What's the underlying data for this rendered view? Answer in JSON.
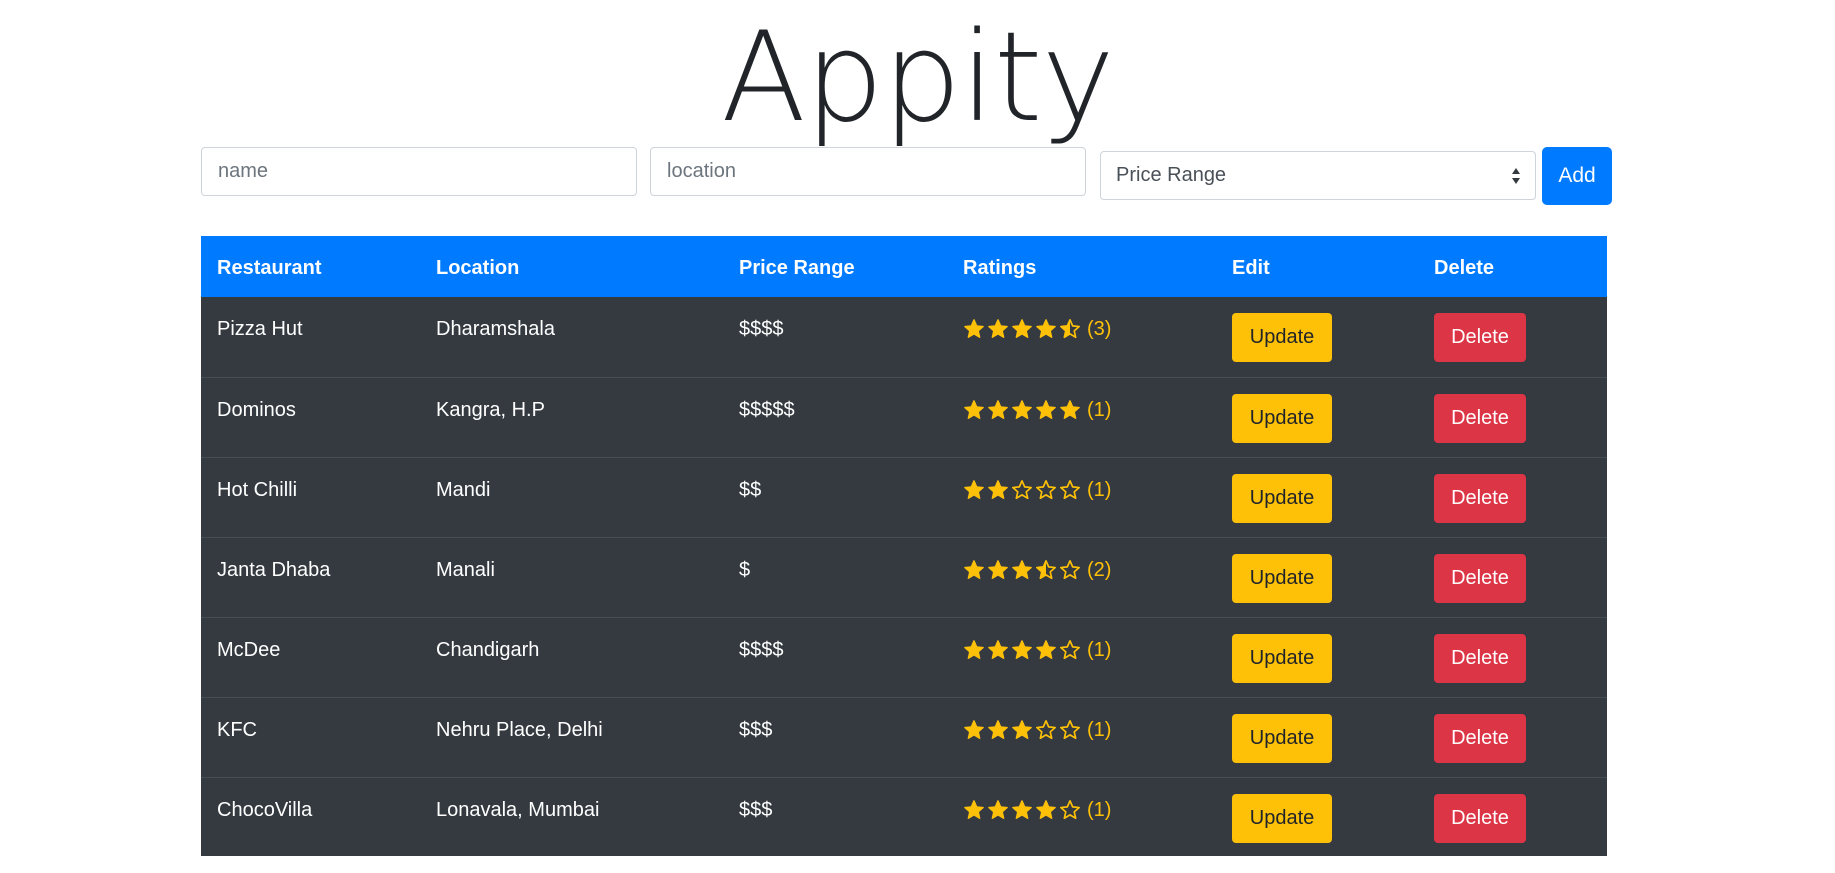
{
  "app": {
    "title": "Appity"
  },
  "form": {
    "name_placeholder": "name",
    "location_placeholder": "location",
    "price_select_value": "Price Range",
    "add_label": "Add"
  },
  "table": {
    "headers": [
      "Restaurant",
      "Location",
      "Price Range",
      "Ratings",
      "Edit",
      "Delete"
    ],
    "rows": [
      {
        "name": "Pizza Hut",
        "location": "Dharamshala",
        "price": "$$$$",
        "rating": 4.5,
        "count": "(3)",
        "update": "Update",
        "delete": "Delete"
      },
      {
        "name": "Dominos",
        "location": "Kangra, H.P",
        "price": "$$$$$",
        "rating": 5,
        "count": "(1)",
        "update": "Update",
        "delete": "Delete"
      },
      {
        "name": "Hot Chilli",
        "location": "Mandi",
        "price": "$$",
        "rating": 2,
        "count": "(1)",
        "update": "Update",
        "delete": "Delete"
      },
      {
        "name": "Janta Dhaba",
        "location": "Manali",
        "price": "$",
        "rating": 3.5,
        "count": "(2)",
        "update": "Update",
        "delete": "Delete"
      },
      {
        "name": "McDee",
        "location": "Chandigarh",
        "price": "$$$$",
        "rating": 4,
        "count": "(1)",
        "update": "Update",
        "delete": "Delete"
      },
      {
        "name": "KFC",
        "location": "Nehru Place, Delhi",
        "price": "$$$",
        "rating": 3,
        "count": "(1)",
        "update": "Update",
        "delete": "Delete"
      },
      {
        "name": "ChocoVilla",
        "location": "Lonavala, Mumbai",
        "price": "$$$",
        "rating": 4,
        "count": "(1)",
        "update": "Update",
        "delete": "Delete"
      }
    ]
  },
  "colors": {
    "primary": "#007bff",
    "warning": "#ffc107",
    "danger": "#dc3545",
    "table_dark": "#343a40",
    "row_border": "#454d55"
  },
  "icons": {
    "star_full": "star-filled-icon",
    "star_half": "star-half-icon",
    "star_empty": "star-empty-icon",
    "caret": "sort-caret-icon"
  }
}
